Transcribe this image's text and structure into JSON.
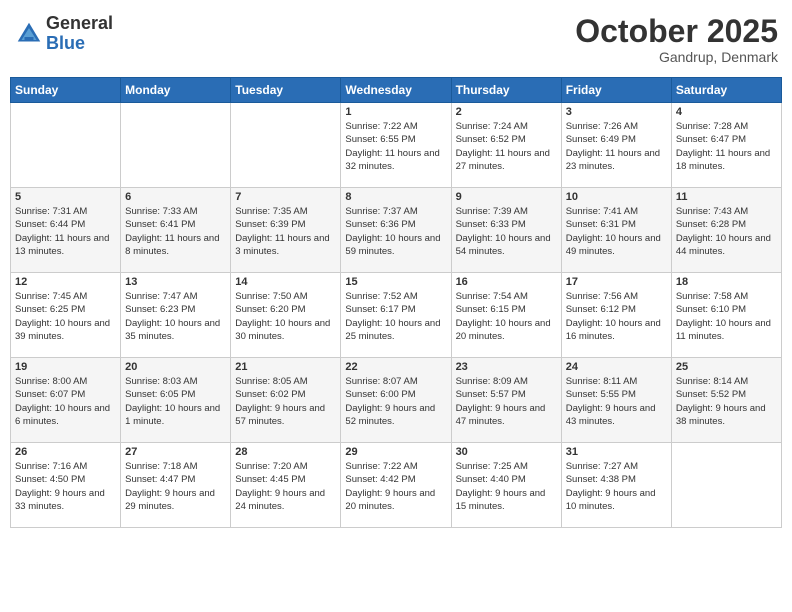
{
  "header": {
    "logo_general": "General",
    "logo_blue": "Blue",
    "month_title": "October 2025",
    "location": "Gandrup, Denmark"
  },
  "days_of_week": [
    "Sunday",
    "Monday",
    "Tuesday",
    "Wednesday",
    "Thursday",
    "Friday",
    "Saturday"
  ],
  "weeks": [
    [
      {
        "day": "",
        "info": ""
      },
      {
        "day": "",
        "info": ""
      },
      {
        "day": "",
        "info": ""
      },
      {
        "day": "1",
        "info": "Sunrise: 7:22 AM\nSunset: 6:55 PM\nDaylight: 11 hours\nand 32 minutes."
      },
      {
        "day": "2",
        "info": "Sunrise: 7:24 AM\nSunset: 6:52 PM\nDaylight: 11 hours\nand 27 minutes."
      },
      {
        "day": "3",
        "info": "Sunrise: 7:26 AM\nSunset: 6:49 PM\nDaylight: 11 hours\nand 23 minutes."
      },
      {
        "day": "4",
        "info": "Sunrise: 7:28 AM\nSunset: 6:47 PM\nDaylight: 11 hours\nand 18 minutes."
      }
    ],
    [
      {
        "day": "5",
        "info": "Sunrise: 7:31 AM\nSunset: 6:44 PM\nDaylight: 11 hours\nand 13 minutes."
      },
      {
        "day": "6",
        "info": "Sunrise: 7:33 AM\nSunset: 6:41 PM\nDaylight: 11 hours\nand 8 minutes."
      },
      {
        "day": "7",
        "info": "Sunrise: 7:35 AM\nSunset: 6:39 PM\nDaylight: 11 hours\nand 3 minutes."
      },
      {
        "day": "8",
        "info": "Sunrise: 7:37 AM\nSunset: 6:36 PM\nDaylight: 10 hours\nand 59 minutes."
      },
      {
        "day": "9",
        "info": "Sunrise: 7:39 AM\nSunset: 6:33 PM\nDaylight: 10 hours\nand 54 minutes."
      },
      {
        "day": "10",
        "info": "Sunrise: 7:41 AM\nSunset: 6:31 PM\nDaylight: 10 hours\nand 49 minutes."
      },
      {
        "day": "11",
        "info": "Sunrise: 7:43 AM\nSunset: 6:28 PM\nDaylight: 10 hours\nand 44 minutes."
      }
    ],
    [
      {
        "day": "12",
        "info": "Sunrise: 7:45 AM\nSunset: 6:25 PM\nDaylight: 10 hours\nand 39 minutes."
      },
      {
        "day": "13",
        "info": "Sunrise: 7:47 AM\nSunset: 6:23 PM\nDaylight: 10 hours\nand 35 minutes."
      },
      {
        "day": "14",
        "info": "Sunrise: 7:50 AM\nSunset: 6:20 PM\nDaylight: 10 hours\nand 30 minutes."
      },
      {
        "day": "15",
        "info": "Sunrise: 7:52 AM\nSunset: 6:17 PM\nDaylight: 10 hours\nand 25 minutes."
      },
      {
        "day": "16",
        "info": "Sunrise: 7:54 AM\nSunset: 6:15 PM\nDaylight: 10 hours\nand 20 minutes."
      },
      {
        "day": "17",
        "info": "Sunrise: 7:56 AM\nSunset: 6:12 PM\nDaylight: 10 hours\nand 16 minutes."
      },
      {
        "day": "18",
        "info": "Sunrise: 7:58 AM\nSunset: 6:10 PM\nDaylight: 10 hours\nand 11 minutes."
      }
    ],
    [
      {
        "day": "19",
        "info": "Sunrise: 8:00 AM\nSunset: 6:07 PM\nDaylight: 10 hours\nand 6 minutes."
      },
      {
        "day": "20",
        "info": "Sunrise: 8:03 AM\nSunset: 6:05 PM\nDaylight: 10 hours\nand 1 minute."
      },
      {
        "day": "21",
        "info": "Sunrise: 8:05 AM\nSunset: 6:02 PM\nDaylight: 9 hours\nand 57 minutes."
      },
      {
        "day": "22",
        "info": "Sunrise: 8:07 AM\nSunset: 6:00 PM\nDaylight: 9 hours\nand 52 minutes."
      },
      {
        "day": "23",
        "info": "Sunrise: 8:09 AM\nSunset: 5:57 PM\nDaylight: 9 hours\nand 47 minutes."
      },
      {
        "day": "24",
        "info": "Sunrise: 8:11 AM\nSunset: 5:55 PM\nDaylight: 9 hours\nand 43 minutes."
      },
      {
        "day": "25",
        "info": "Sunrise: 8:14 AM\nSunset: 5:52 PM\nDaylight: 9 hours\nand 38 minutes."
      }
    ],
    [
      {
        "day": "26",
        "info": "Sunrise: 7:16 AM\nSunset: 4:50 PM\nDaylight: 9 hours\nand 33 minutes."
      },
      {
        "day": "27",
        "info": "Sunrise: 7:18 AM\nSunset: 4:47 PM\nDaylight: 9 hours\nand 29 minutes."
      },
      {
        "day": "28",
        "info": "Sunrise: 7:20 AM\nSunset: 4:45 PM\nDaylight: 9 hours\nand 24 minutes."
      },
      {
        "day": "29",
        "info": "Sunrise: 7:22 AM\nSunset: 4:42 PM\nDaylight: 9 hours\nand 20 minutes."
      },
      {
        "day": "30",
        "info": "Sunrise: 7:25 AM\nSunset: 4:40 PM\nDaylight: 9 hours\nand 15 minutes."
      },
      {
        "day": "31",
        "info": "Sunrise: 7:27 AM\nSunset: 4:38 PM\nDaylight: 9 hours\nand 10 minutes."
      },
      {
        "day": "",
        "info": ""
      }
    ]
  ]
}
